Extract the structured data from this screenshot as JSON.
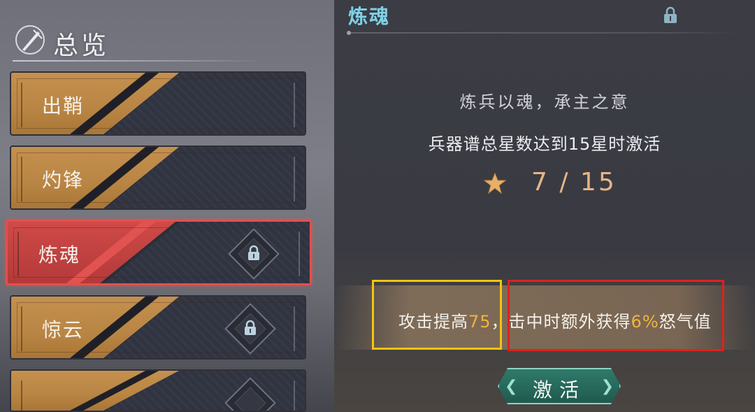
{
  "sidebar": {
    "header": "总览",
    "tabs": [
      {
        "label": "出鞘",
        "locked": false,
        "active": false
      },
      {
        "label": "灼锋",
        "locked": false,
        "active": false
      },
      {
        "label": "炼魂",
        "locked": true,
        "active": true
      },
      {
        "label": "惊云",
        "locked": true,
        "active": false
      },
      {
        "label": "",
        "locked": true,
        "active": false
      }
    ]
  },
  "panel": {
    "title": "炼魂",
    "motto": "炼兵以魂，承主之意",
    "requirement": "兵器谱总星数达到15星时激活",
    "progress": "7 / 15",
    "bonus": {
      "part1_prefix": "攻击提高",
      "part1_value": "75",
      "separator": "，",
      "part2_prefix": "击中时额外获得",
      "part2_value": "6%",
      "part2_suffix": "怒气值"
    },
    "activate_button": "激活"
  },
  "colors": {
    "accent_teal": "#7ed1e6",
    "active_red": "#e0514f",
    "highlight_gold": "#f0b43a",
    "annotation_yellow": "#f2c40f",
    "annotation_red": "#e0211c"
  },
  "icons": {
    "header": "sword-emblem-icon",
    "lock": "lock-icon",
    "star": "star-icon"
  }
}
